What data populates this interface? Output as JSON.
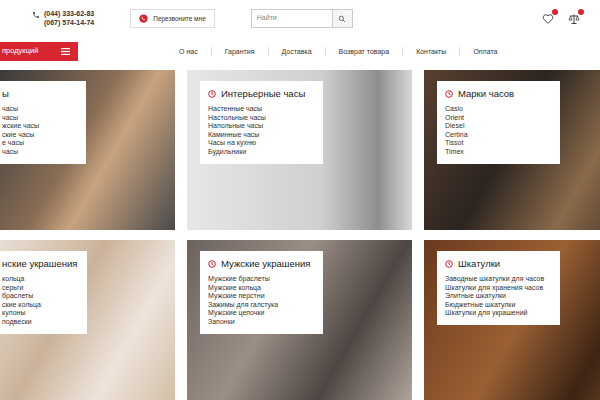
{
  "header": {
    "phones": [
      "(044) 333-62-83",
      "(067) 574-14-74"
    ],
    "callback_button": "Перезвоните мне",
    "search": {
      "placeholder": "Найти"
    }
  },
  "catalog_button": "продукций",
  "menu": [
    "О нас",
    "Гарантия",
    "Доставка",
    "Возврат товара",
    "Контакты",
    "Оплата"
  ],
  "tiles": [
    {
      "title": "ы",
      "items": [
        "часы",
        "часы",
        "жские часы",
        "ские часы",
        "е часы",
        "часы"
      ]
    },
    {
      "title": "Интерьерные часы",
      "items": [
        "Настенные часы",
        "Настольные часы",
        "Напольные часы",
        "Каминные часы",
        "Часы на кухню",
        "Будильники"
      ]
    },
    {
      "title": "Марки часов",
      "items": [
        "Casio",
        "Orient",
        "Diesel",
        "Certina",
        "Tissot",
        "Timex"
      ]
    },
    {
      "title": "нские украшения",
      "items": [
        "кольца",
        "серьги",
        "браслеты",
        "ские кольца",
        "кулоны",
        "подвески"
      ]
    },
    {
      "title": "Мужские украшения",
      "items": [
        "Мужские браслеты",
        "Мужские кольца",
        "Мужские перстни",
        "Зажимы для галстука",
        "Мужские цепочки",
        "Запонки"
      ]
    },
    {
      "title": "Шкатулки",
      "items": [
        "Заводные шкатулки для часов",
        "Шкатулки для хранения часов",
        "Элитные шкатулки",
        "Бюджетные шкатулки",
        "Шкатулки для украшений"
      ]
    }
  ]
}
